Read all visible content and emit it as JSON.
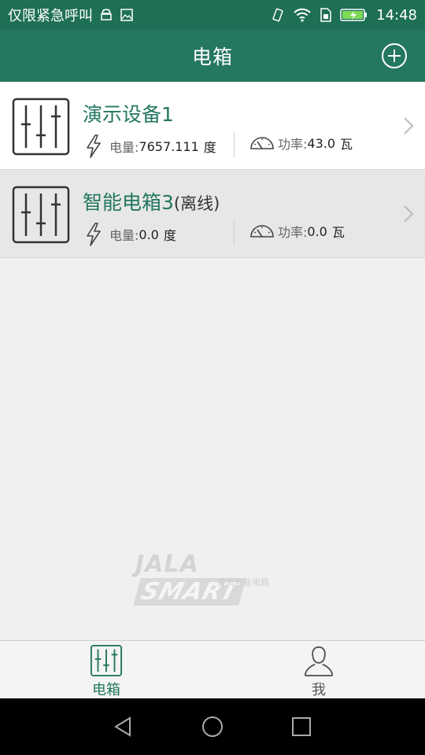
{
  "status_bar": {
    "carrier": "仅限紧急呼叫",
    "time": "14:48",
    "icons": [
      "android-icon",
      "image-icon",
      "vibrate-icon",
      "wifi-icon",
      "sim-icon",
      "battery-charging-icon"
    ]
  },
  "header": {
    "title": "电箱",
    "add_icon": "plus-circle-icon"
  },
  "devices": [
    {
      "name": "演示设备1",
      "suffix": "",
      "energy_label": "电量:",
      "energy_value": "7657.111",
      "energy_unit": "度",
      "power_label": "功率:",
      "power_value": "43.0",
      "power_unit": "瓦",
      "status": "online"
    },
    {
      "name": "智能电箱3",
      "suffix": "(离线)",
      "energy_label": "电量:",
      "energy_value": "0.0",
      "energy_unit": "度",
      "power_label": "功率:",
      "power_value": "0.0",
      "power_unit": "瓦",
      "status": "offline"
    }
  ],
  "watermark": {
    "brand": "JALA",
    "brand2": "SMART",
    "subtitle": "佳岚智能电箱"
  },
  "tabs": [
    {
      "label": "电箱",
      "icon": "switchboard-icon",
      "active": true
    },
    {
      "label": "我",
      "icon": "user-icon",
      "active": false
    }
  ],
  "nav": [
    "back-icon",
    "home-icon",
    "recent-apps-icon"
  ],
  "colors": {
    "primary": "#247760",
    "status_bar": "#1e6f56",
    "background": "#eff0f2"
  }
}
